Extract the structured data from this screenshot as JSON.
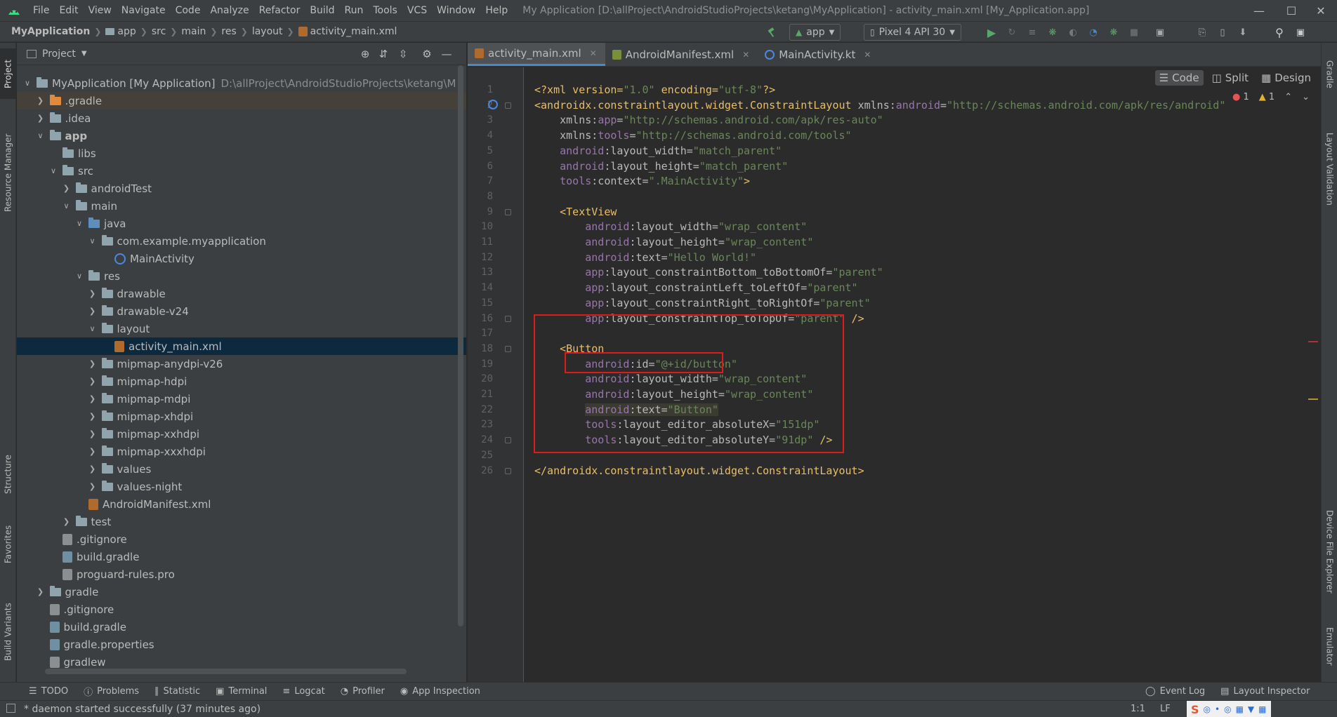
{
  "app": {
    "menu": [
      "File",
      "Edit",
      "View",
      "Navigate",
      "Code",
      "Analyze",
      "Refactor",
      "Build",
      "Run",
      "Tools",
      "VCS",
      "Window",
      "Help"
    ],
    "window_title": "My Application [D:\\allProject\\AndroidStudioProjects\\ketang\\MyApplication] - activity_main.xml [My_Application.app]"
  },
  "breadcrumb": [
    "MyApplication",
    "app",
    "src",
    "main",
    "res",
    "layout",
    "activity_main.xml"
  ],
  "toolbar": {
    "run_config": "app",
    "device": "Pixel 4 API 30"
  },
  "left_stripe": {
    "tabs": [
      "Project",
      "Resource Manager",
      "Structure",
      "Favorites",
      "Build Variants"
    ]
  },
  "right_stripe": {
    "tabs": [
      "Gradle",
      "Layout Validation",
      "Device File Explorer",
      "Emulator"
    ]
  },
  "project_panel": {
    "title": "Project",
    "tree": [
      {
        "label": "MyApplication [My Application]",
        "extra": "D:\\allProject\\AndroidStudioProjects\\ketang\\M",
        "depth": 0,
        "arrow": "open",
        "icon": "module"
      },
      {
        "label": ".gradle",
        "depth": 1,
        "arrow": "closed",
        "icon": "folder-orange",
        "hl": "gradle"
      },
      {
        "label": ".idea",
        "depth": 1,
        "arrow": "closed",
        "icon": "folder"
      },
      {
        "label": "app",
        "depth": 1,
        "arrow": "open",
        "icon": "module",
        "bold": true
      },
      {
        "label": "libs",
        "depth": 2,
        "arrow": "none",
        "icon": "folder"
      },
      {
        "label": "src",
        "depth": 2,
        "arrow": "open",
        "icon": "folder"
      },
      {
        "label": "androidTest",
        "depth": 3,
        "arrow": "closed",
        "icon": "folder"
      },
      {
        "label": "main",
        "depth": 3,
        "arrow": "open",
        "icon": "folder"
      },
      {
        "label": "java",
        "depth": 4,
        "arrow": "open",
        "icon": "folder-blue"
      },
      {
        "label": "com.example.myapplication",
        "depth": 5,
        "arrow": "open",
        "icon": "folder"
      },
      {
        "label": "MainActivity",
        "depth": 6,
        "arrow": "none",
        "icon": "kotlin"
      },
      {
        "label": "res",
        "depth": 4,
        "arrow": "open",
        "icon": "folder"
      },
      {
        "label": "drawable",
        "depth": 5,
        "arrow": "closed",
        "icon": "folder"
      },
      {
        "label": "drawable-v24",
        "depth": 5,
        "arrow": "closed",
        "icon": "folder"
      },
      {
        "label": "layout",
        "depth": 5,
        "arrow": "open",
        "icon": "folder"
      },
      {
        "label": "activity_main.xml",
        "depth": 6,
        "arrow": "none",
        "icon": "xml",
        "selected": true
      },
      {
        "label": "mipmap-anydpi-v26",
        "depth": 5,
        "arrow": "closed",
        "icon": "folder"
      },
      {
        "label": "mipmap-hdpi",
        "depth": 5,
        "arrow": "closed",
        "icon": "folder"
      },
      {
        "label": "mipmap-mdpi",
        "depth": 5,
        "arrow": "closed",
        "icon": "folder"
      },
      {
        "label": "mipmap-xhdpi",
        "depth": 5,
        "arrow": "closed",
        "icon": "folder"
      },
      {
        "label": "mipmap-xxhdpi",
        "depth": 5,
        "arrow": "closed",
        "icon": "folder"
      },
      {
        "label": "mipmap-xxxhdpi",
        "depth": 5,
        "arrow": "closed",
        "icon": "folder"
      },
      {
        "label": "values",
        "depth": 5,
        "arrow": "closed",
        "icon": "folder"
      },
      {
        "label": "values-night",
        "depth": 5,
        "arrow": "closed",
        "icon": "folder"
      },
      {
        "label": "AndroidManifest.xml",
        "depth": 4,
        "arrow": "none",
        "icon": "xml"
      },
      {
        "label": "test",
        "depth": 3,
        "arrow": "closed",
        "icon": "folder"
      },
      {
        "label": ".gitignore",
        "depth": 2,
        "arrow": "none",
        "icon": "text"
      },
      {
        "label": "build.gradle",
        "depth": 2,
        "arrow": "none",
        "icon": "gradle"
      },
      {
        "label": "proguard-rules.pro",
        "depth": 2,
        "arrow": "none",
        "icon": "text"
      },
      {
        "label": "gradle",
        "depth": 1,
        "arrow": "closed",
        "icon": "folder"
      },
      {
        "label": ".gitignore",
        "depth": 1,
        "arrow": "none",
        "icon": "text"
      },
      {
        "label": "build.gradle",
        "depth": 1,
        "arrow": "none",
        "icon": "gradle"
      },
      {
        "label": "gradle.properties",
        "depth": 1,
        "arrow": "none",
        "icon": "gradle"
      },
      {
        "label": "gradlew",
        "depth": 1,
        "arrow": "none",
        "icon": "text"
      }
    ]
  },
  "editor_tabs": [
    {
      "label": "activity_main.xml",
      "icon": "xml",
      "active": true
    },
    {
      "label": "AndroidManifest.xml",
      "icon": "xml",
      "active": false
    },
    {
      "label": "MainActivity.kt",
      "icon": "kotlin",
      "active": false
    }
  ],
  "view_modes": [
    "Code",
    "Split",
    "Design"
  ],
  "inspections": {
    "errors": "1",
    "warnings": "1"
  },
  "code_lines": [
    [
      {
        "t": "<?xml version=",
        "c": "t-tag"
      },
      {
        "t": "\"1.0\"",
        "c": "t-val"
      },
      {
        "t": " encoding=",
        "c": "t-tag"
      },
      {
        "t": "\"utf-8\"",
        "c": "t-val"
      },
      {
        "t": "?>",
        "c": "t-tag"
      }
    ],
    [
      {
        "t": "<androidx.constraintlayout.widget.ConstraintLayout ",
        "c": "t-tag"
      },
      {
        "t": "xmlns:",
        "c": "t-attr"
      },
      {
        "t": "android",
        "c": "t-ns"
      },
      {
        "t": "=",
        "c": "t-attr"
      },
      {
        "t": "\"http://schemas.android.com/apk/res/android\"",
        "c": "t-val"
      }
    ],
    [
      {
        "t": "    xmlns:",
        "c": "t-attr"
      },
      {
        "t": "app",
        "c": "t-ns"
      },
      {
        "t": "=",
        "c": "t-attr"
      },
      {
        "t": "\"http://schemas.android.com/apk/res-auto\"",
        "c": "t-val"
      }
    ],
    [
      {
        "t": "    xmlns:",
        "c": "t-attr"
      },
      {
        "t": "tools",
        "c": "t-ns"
      },
      {
        "t": "=",
        "c": "t-attr"
      },
      {
        "t": "\"http://schemas.android.com/tools\"",
        "c": "t-val"
      }
    ],
    [
      {
        "t": "    ",
        "c": "t-attr"
      },
      {
        "t": "android",
        "c": "t-ns"
      },
      {
        "t": ":layout_width=",
        "c": "t-attr"
      },
      {
        "t": "\"match_parent\"",
        "c": "t-val"
      }
    ],
    [
      {
        "t": "    ",
        "c": "t-attr"
      },
      {
        "t": "android",
        "c": "t-ns"
      },
      {
        "t": ":layout_height=",
        "c": "t-attr"
      },
      {
        "t": "\"match_parent\"",
        "c": "t-val"
      }
    ],
    [
      {
        "t": "    ",
        "c": "t-attr"
      },
      {
        "t": "tools",
        "c": "t-ns"
      },
      {
        "t": ":context=",
        "c": "t-attr"
      },
      {
        "t": "\".MainActivity\"",
        "c": "t-val"
      },
      {
        "t": ">",
        "c": "t-tag"
      }
    ],
    [],
    [
      {
        "t": "    <TextView",
        "c": "t-tag"
      }
    ],
    [
      {
        "t": "        ",
        "c": "t-attr"
      },
      {
        "t": "android",
        "c": "t-ns"
      },
      {
        "t": ":layout_width=",
        "c": "t-attr"
      },
      {
        "t": "\"wrap_content\"",
        "c": "t-val"
      }
    ],
    [
      {
        "t": "        ",
        "c": "t-attr"
      },
      {
        "t": "android",
        "c": "t-ns"
      },
      {
        "t": ":layout_height=",
        "c": "t-attr"
      },
      {
        "t": "\"wrap_content\"",
        "c": "t-val"
      }
    ],
    [
      {
        "t": "        ",
        "c": "t-attr"
      },
      {
        "t": "android",
        "c": "t-ns"
      },
      {
        "t": ":text=",
        "c": "t-attr"
      },
      {
        "t": "\"Hello World!\"",
        "c": "t-val"
      }
    ],
    [
      {
        "t": "        ",
        "c": "t-attr"
      },
      {
        "t": "app",
        "c": "t-ns"
      },
      {
        "t": ":layout_constraintBottom_toBottomOf=",
        "c": "t-attr"
      },
      {
        "t": "\"parent\"",
        "c": "t-val"
      }
    ],
    [
      {
        "t": "        ",
        "c": "t-attr"
      },
      {
        "t": "app",
        "c": "t-ns"
      },
      {
        "t": ":layout_constraintLeft_toLeftOf=",
        "c": "t-attr"
      },
      {
        "t": "\"parent\"",
        "c": "t-val"
      }
    ],
    [
      {
        "t": "        ",
        "c": "t-attr"
      },
      {
        "t": "app",
        "c": "t-ns"
      },
      {
        "t": ":layout_constraintRight_toRightOf=",
        "c": "t-attr"
      },
      {
        "t": "\"parent\"",
        "c": "t-val"
      }
    ],
    [
      {
        "t": "        ",
        "c": "t-attr"
      },
      {
        "t": "app",
        "c": "t-ns"
      },
      {
        "t": ":layout_constraintTop_toTopOf=",
        "c": "t-attr"
      },
      {
        "t": "\"parent\"",
        "c": "t-val"
      },
      {
        "t": " />",
        "c": "t-tag"
      }
    ],
    [],
    [
      {
        "t": "    <Button",
        "c": "t-tag"
      }
    ],
    [
      {
        "t": "        ",
        "c": "t-attr"
      },
      {
        "t": "android",
        "c": "t-ns"
      },
      {
        "t": ":id=",
        "c": "t-attr"
      },
      {
        "t": "\"@+id/button\"",
        "c": "t-val"
      }
    ],
    [
      {
        "t": "        ",
        "c": "t-attr"
      },
      {
        "t": "android",
        "c": "t-ns"
      },
      {
        "t": ":layout_width=",
        "c": "t-attr"
      },
      {
        "t": "\"wrap_content\"",
        "c": "t-val"
      }
    ],
    [
      {
        "t": "        ",
        "c": "t-attr"
      },
      {
        "t": "android",
        "c": "t-ns"
      },
      {
        "t": ":layout_height=",
        "c": "t-attr"
      },
      {
        "t": "\"wrap_content\"",
        "c": "t-val"
      }
    ],
    [
      {
        "t": "        ",
        "c": "t-attr"
      },
      {
        "t": "android",
        "c": "t-ns hl-dim"
      },
      {
        "t": ":text=",
        "c": "t-attr hl-dim"
      },
      {
        "t": "\"Button\"",
        "c": "t-val hl-dim"
      }
    ],
    [
      {
        "t": "        ",
        "c": "t-attr"
      },
      {
        "t": "tools",
        "c": "t-ns"
      },
      {
        "t": ":layout_editor_absoluteX=",
        "c": "t-attr"
      },
      {
        "t": "\"151dp\"",
        "c": "t-val"
      }
    ],
    [
      {
        "t": "        ",
        "c": "t-attr"
      },
      {
        "t": "tools",
        "c": "t-ns"
      },
      {
        "t": ":layout_editor_absoluteY=",
        "c": "t-attr"
      },
      {
        "t": "\"91dp\"",
        "c": "t-val"
      },
      {
        "t": " />",
        "c": "t-tag"
      }
    ],
    [],
    [
      {
        "t": "</androidx.constraintlayout.widget.ConstraintLayout>",
        "c": "t-tag"
      }
    ]
  ],
  "bottom_tools": [
    "TODO",
    "Problems",
    "Statistic",
    "Terminal",
    "Logcat",
    "Profiler",
    "App Inspection"
  ],
  "bottom_tools_right": [
    "Event Log",
    "Layout Inspector"
  ],
  "status": {
    "message": "* daemon started successfully (37 minutes ago)",
    "position": "1:1",
    "line_sep": "LF"
  },
  "colors": {
    "accent": "#4a88c7",
    "annotation_red": "#e01919",
    "run_green": "#59a869"
  }
}
